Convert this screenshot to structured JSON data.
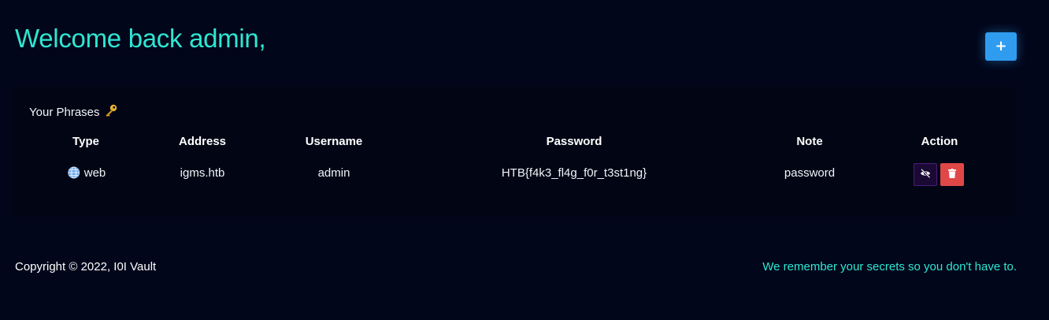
{
  "header": {
    "welcome": "Welcome back admin,",
    "add_button_label": "+"
  },
  "colors": {
    "background": "#02061a",
    "accent": "#2ee6d2",
    "add_button": "#2f9cf0",
    "delete_button": "#e04848",
    "view_button": "#1a0a33"
  },
  "phrases": {
    "title": "Your Phrases",
    "title_icon": "key-icon",
    "columns": [
      "Type",
      "Address",
      "Username",
      "Password",
      "Note",
      "Action"
    ],
    "rows": [
      {
        "type_icon": "globe-icon",
        "type": "web",
        "address": "igms.htb",
        "username": "admin",
        "password": "HTB{f4k3_fl4g_f0r_t3st1ng}",
        "note": "password",
        "actions": [
          "eye-slash-icon",
          "trash-icon"
        ]
      }
    ]
  },
  "footer": {
    "copyright": "Copyright © 2022, I0I Vault",
    "tagline": "We remember your secrets so you don't have to."
  }
}
